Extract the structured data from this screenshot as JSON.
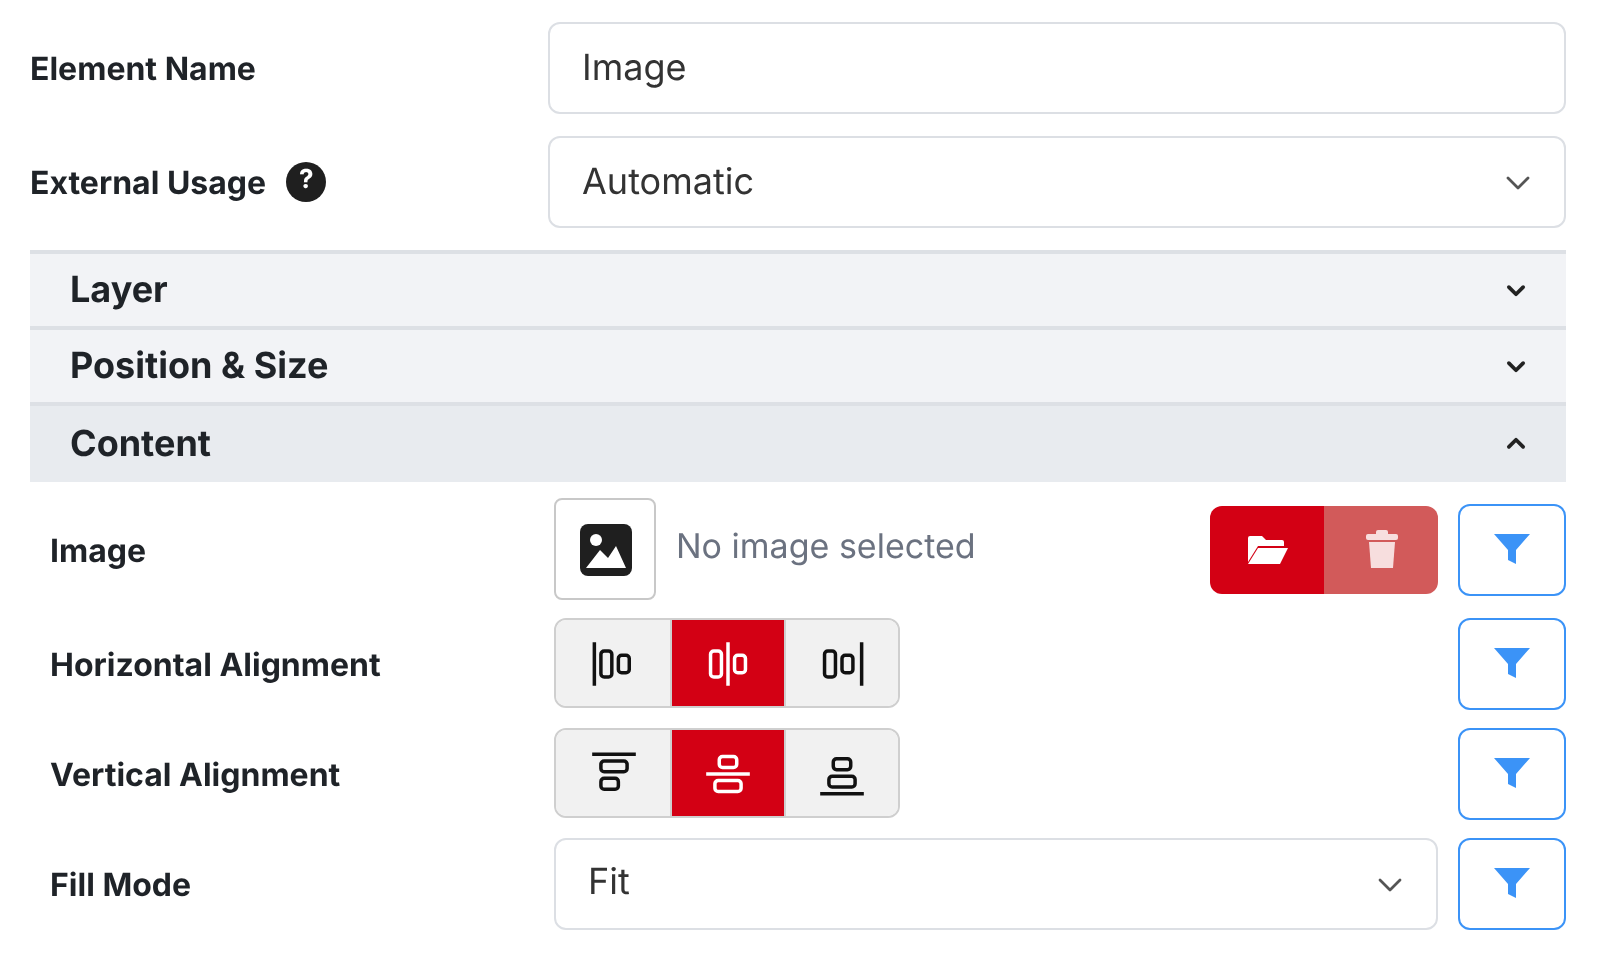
{
  "fields": [
    {
      "label": "Element Name",
      "kind": "text",
      "value": "Image"
    },
    {
      "label": "External Usage",
      "kind": "select",
      "value": "Automatic",
      "help": "?"
    }
  ],
  "sections": [
    {
      "title": "Layer",
      "expanded": false
    },
    {
      "title": "Position & Size",
      "expanded": false
    },
    {
      "title": "Content",
      "expanded": true,
      "rows": [
        {
          "label": "Image",
          "kind": "image",
          "text": "No image selected",
          "actions": [
            {
              "kind": "browse",
              "disabled": false
            },
            {
              "kind": "delete",
              "disabled": true
            }
          ]
        },
        {
          "label": "Horizontal Alignment",
          "kind": "align",
          "options": [
            {
              "kind": "left",
              "selected": false
            },
            {
              "kind": "center",
              "selected": true
            },
            {
              "kind": "right",
              "selected": false
            }
          ]
        },
        {
          "label": "Vertical Alignment",
          "kind": "align",
          "options": [
            {
              "kind": "top",
              "selected": false
            },
            {
              "kind": "middle",
              "selected": true
            },
            {
              "kind": "bottom",
              "selected": false
            }
          ]
        },
        {
          "label": "Fill Mode",
          "kind": "select",
          "value": "Fit"
        }
      ]
    }
  ]
}
